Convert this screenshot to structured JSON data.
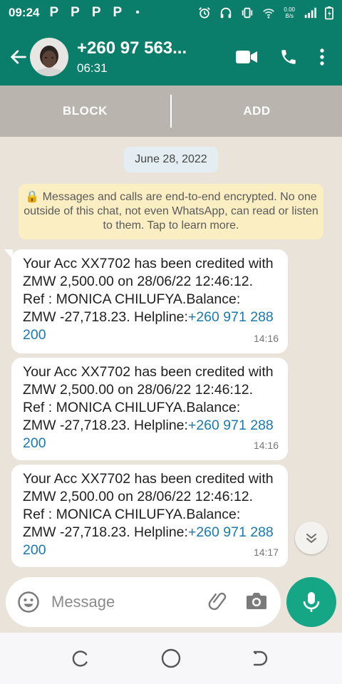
{
  "status": {
    "time": "09:24",
    "p1": "P",
    "p2": "P",
    "p3": "P",
    "p4": "P",
    "dot": "•",
    "speed_top": "0.00",
    "speed_bottom": "B/s",
    "icons": [
      "alarm-icon",
      "headset-icon",
      "vibrate-icon",
      "wifi-icon",
      "signal-icon",
      "battery-icon"
    ]
  },
  "header": {
    "name": "+260 97 563...",
    "subtitle": "06:31",
    "icons": [
      "back-arrow-icon",
      "video-call-icon",
      "phone-icon",
      "more-vert-icon"
    ]
  },
  "action_bar": {
    "block_label": "BLOCK",
    "add_label": "ADD"
  },
  "chat": {
    "date": "June 28, 2022",
    "encryption_notice": "🔒 Messages and calls are end-to-end encrypted. No one outside of this chat, not even WhatsApp, can read or listen to them. Tap to learn more.",
    "messages": [
      {
        "text": "Your Acc XX7702 has been credited with ZMW 2,500.00 on 28/06/22 12:46:12. Ref : MONICA CHILUFYA.Balance: ZMW -27,718.23. Helpline:",
        "link": "+260 971 288 200",
        "time": "14:16"
      },
      {
        "text": "Your Acc XX7702 has been credited with ZMW 2,500.00 on 28/06/22 12:46:12. Ref : MONICA CHILUFYA.Balance: ZMW -27,718.23. Helpline:",
        "link": "+260 971 288 200",
        "time": "14:16"
      },
      {
        "text": "Your Acc XX7702 has been credited with ZMW 2,500.00 on 28/06/22 12:46:12. Ref : MONICA CHILUFYA.Balance: ZMW -27,718.23. Helpline:",
        "link": "+260 971 288 200",
        "time": "14:17"
      }
    ]
  },
  "composer": {
    "placeholder": "Message"
  },
  "colors": {
    "header": "#0b7d6b",
    "accent": "#15a686",
    "bubble": "#ffffff",
    "notice": "#fbeec3",
    "link": "#1a7ab0"
  }
}
